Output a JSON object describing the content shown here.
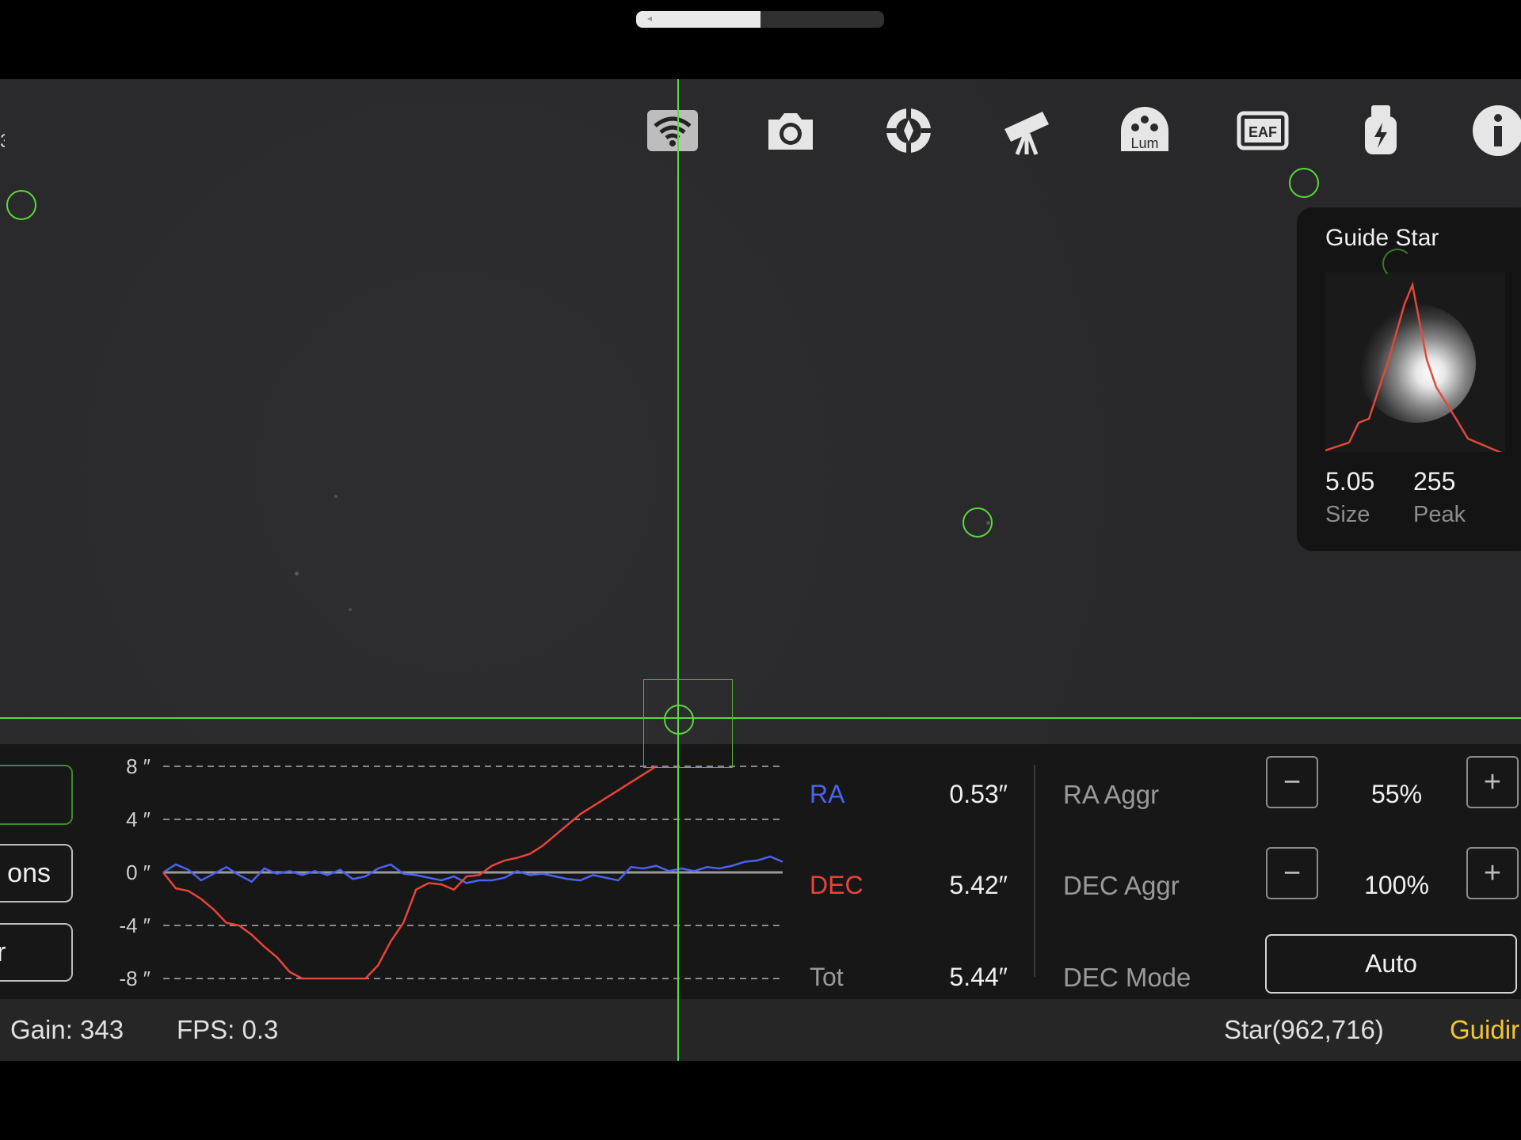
{
  "top_slider": {
    "level": 0.5
  },
  "toolbar": {
    "icons": [
      "wifi-icon",
      "camera-icon",
      "crosshair-target-icon",
      "telescope-icon",
      "filter-wheel-icon",
      "eaf-icon",
      "usb-power-icon",
      "info-icon"
    ],
    "filter_label": "Lum",
    "eaf_label": "EAF"
  },
  "guide_star": {
    "title": "Guide Star",
    "size_value": "5.05",
    "size_label": "Size",
    "peak_value": "255",
    "peak_label": "Peak"
  },
  "left_buttons": {
    "options_partial": "ons",
    "third_partial": "r"
  },
  "chart_data": {
    "type": "line",
    "yticks": [
      "8 ″",
      "4 ″",
      "0 ″",
      "-4 ″",
      "-8 ″"
    ],
    "ylim": [
      -8,
      8
    ],
    "x": [
      0,
      1,
      2,
      3,
      4,
      5,
      6,
      7,
      8,
      9,
      10,
      11,
      12,
      13,
      14,
      15,
      16,
      17,
      18,
      19,
      20,
      21,
      22,
      23,
      24,
      25,
      26,
      27,
      28,
      29,
      30,
      31,
      32,
      33,
      34,
      35,
      36,
      37,
      38,
      39,
      40,
      41,
      42,
      43,
      44,
      45,
      46,
      47,
      48,
      49
    ],
    "series": [
      {
        "name": "RA",
        "color": "#4a63f0",
        "values": [
          0,
          0.6,
          0.2,
          -0.6,
          -0.1,
          0.4,
          -0.2,
          -0.7,
          0.3,
          -0.1,
          0.1,
          -0.2,
          0.1,
          -0.2,
          0.2,
          -0.5,
          -0.3,
          0.3,
          0.6,
          -0.1,
          -0.2,
          -0.4,
          -0.6,
          -0.3,
          -0.8,
          -0.6,
          -0.6,
          -0.4,
          0.1,
          -0.2,
          -0.1,
          -0.3,
          -0.5,
          -0.6,
          -0.2,
          -0.4,
          -0.6,
          0.4,
          0.3,
          0.5,
          0.1,
          0.3,
          0.1,
          0.4,
          0.3,
          0.5,
          0.8,
          0.9,
          1.2,
          0.8
        ]
      },
      {
        "name": "DEC",
        "color": "#e8443a",
        "values": [
          0,
          -1.2,
          -1.4,
          -2.0,
          -2.8,
          -3.8,
          -4.0,
          -4.7,
          -5.6,
          -6.4,
          -7.5,
          -8,
          -8,
          -8,
          -8,
          -8,
          -8,
          -7.0,
          -5.2,
          -3.8,
          -1.3,
          -0.8,
          -0.9,
          -1.3,
          -0.3,
          -0.2,
          0.5,
          0.9,
          1.1,
          1.4,
          2.0,
          2.8,
          3.6,
          4.4,
          5.0,
          5.6,
          6.2,
          6.8,
          7.4,
          8
        ]
      }
    ]
  },
  "stats": {
    "ra_label": "RA",
    "ra_value": "0.53″",
    "dec_label": "DEC",
    "dec_value": "5.42″",
    "tot_label": "Tot",
    "tot_value": "5.44″"
  },
  "aggr": {
    "ra_label": "RA Aggr",
    "ra_value": "55%",
    "dec_label": "DEC Aggr",
    "dec_value": "100%",
    "minus": "−",
    "plus": "+",
    "mode_label": "DEC Mode",
    "mode_value": "Auto"
  },
  "status": {
    "gain": "Gain: 343",
    "fps": "FPS: 0.3",
    "star": "Star(962,716)",
    "state": "Guidir",
    "state_color": "#f2c530"
  }
}
